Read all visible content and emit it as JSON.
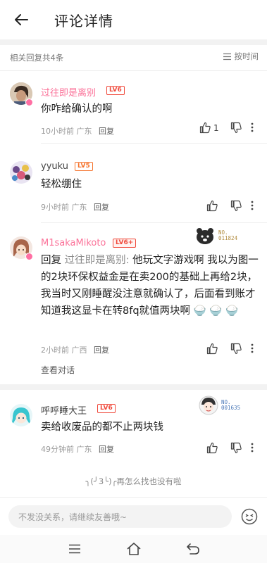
{
  "header": {
    "title": "评论详情"
  },
  "summary": {
    "count_text": "相关回复共4条",
    "sort_label": "按时间"
  },
  "comments": [
    {
      "username": "过往即是离别",
      "level": "LV6",
      "text": "你咋给确认的啊",
      "time": "10小时前",
      "location": "广东",
      "reply_label": "回复",
      "like_count": "1"
    },
    {
      "username": "yyuku",
      "level": "LV5",
      "text": "轻松绷住",
      "time": "9小时前",
      "location": "广东",
      "reply_label": "回复"
    },
    {
      "username": "M1sakaMikoto",
      "level": "LV6+",
      "medal_no": "NO.",
      "medal_id": "011824",
      "reply_prefix": "回复",
      "reply_to": "过往即是离别:",
      "text": "他玩文字游戏啊 我以为图一的2块环保权益金是在卖200的基础上再给2块，我当时又刚睡醒没注意就确认了，后面看到账才知道我这显卡在转8fq就值两块啊",
      "time": "2小时前",
      "location": "广西",
      "reply_label": "回复",
      "view_conversation": "查看对话"
    },
    {
      "username": "呼呼睡大王",
      "level": "LV6",
      "medal_no": "NO.",
      "medal_id": "001635",
      "text": "卖给收废品的都不止两块钱",
      "time": "49分钟前",
      "location": "广东",
      "reply_label": "回复"
    }
  ],
  "end_note": "╮(╯3╰)╭再怎么找也没有啦",
  "input": {
    "placeholder": "不发没关系，请继续友善哦~"
  },
  "colors": {
    "pink": "#fb7299",
    "level_orange": "#f5722b",
    "level_red": "#f04a3c"
  }
}
